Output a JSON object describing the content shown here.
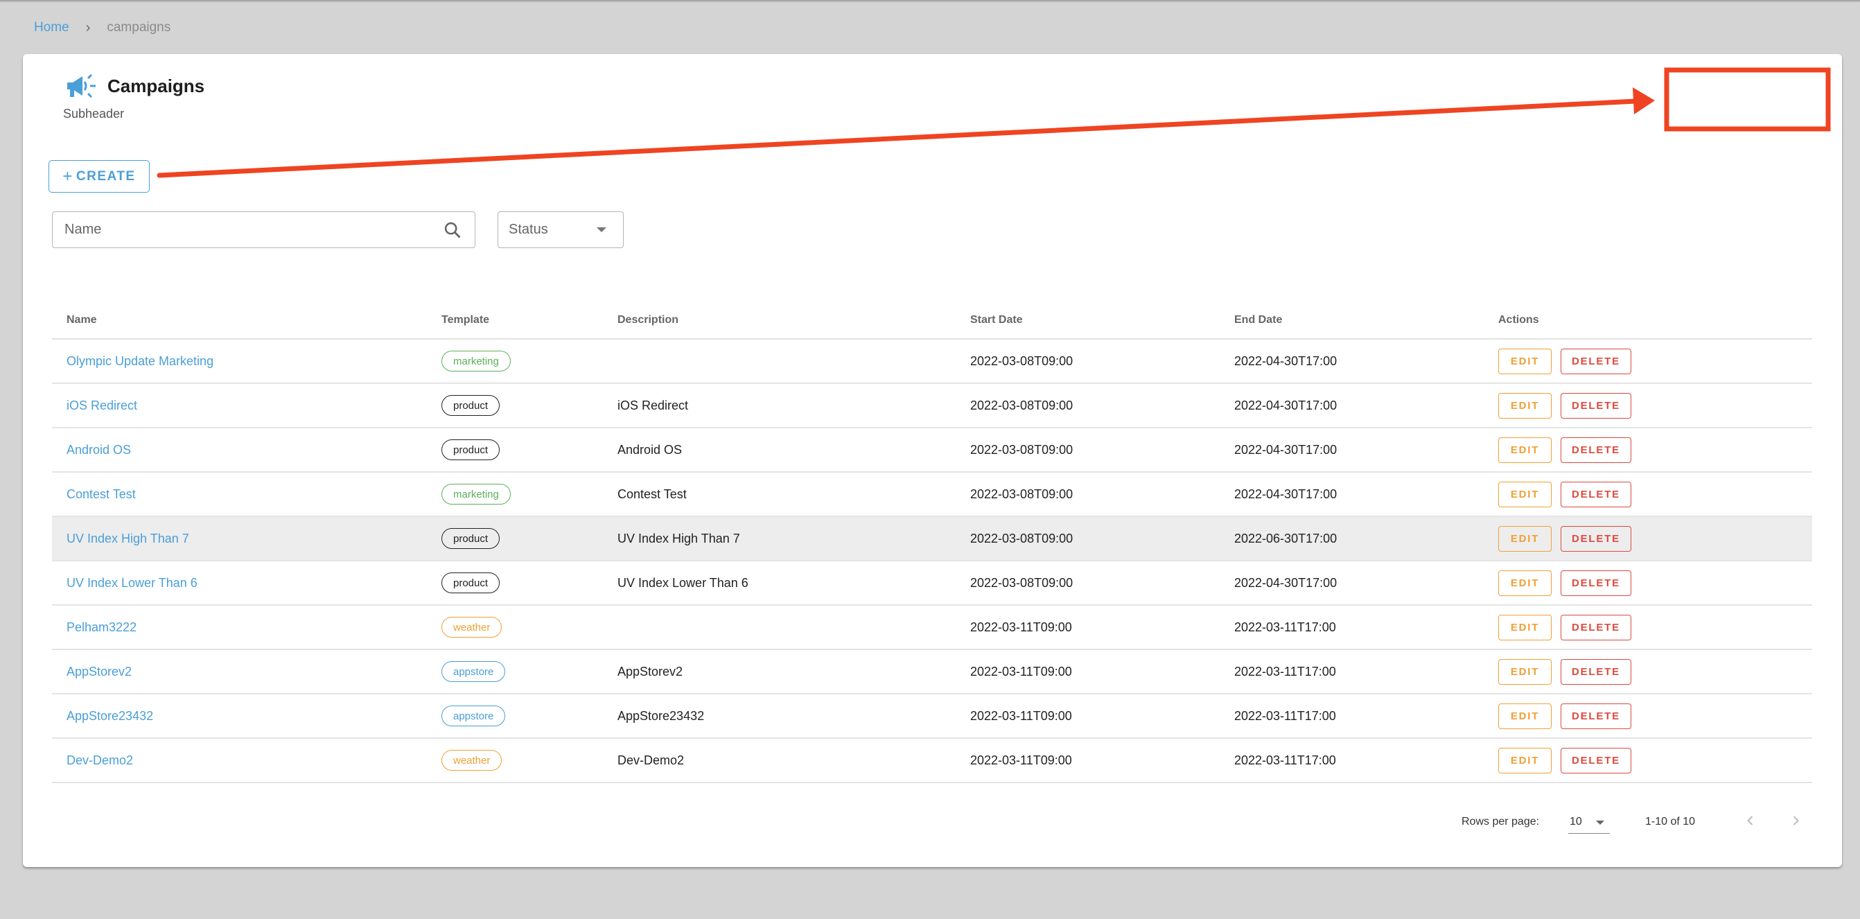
{
  "breadcrumb": {
    "home": "Home",
    "separator_icon": "chevron-right-icon",
    "current": "campaigns"
  },
  "header": {
    "icon": "megaphone-icon",
    "title": "Campaigns",
    "subheader": "Subheader",
    "accent_color": "#4a9fd8"
  },
  "toolbar": {
    "create_label": "CREATE",
    "create_icon": "plus-icon"
  },
  "filters": {
    "name_placeholder": "Name",
    "name_value": "",
    "search_icon": "search-icon",
    "status_placeholder": "Status"
  },
  "table": {
    "columns": [
      "Name",
      "Template",
      "Description",
      "Start Date",
      "End Date",
      "Actions"
    ],
    "edit_label": "EDIT",
    "delete_label": "DELETE",
    "template_colors": {
      "marketing": "#5cb05c",
      "product": "#222222",
      "weather": "#f0a035",
      "appstore": "#4a9fd8"
    },
    "rows": [
      {
        "name": "Olympic Update Marketing",
        "template": "marketing",
        "description": "",
        "start": "2022-03-08T09:00",
        "end": "2022-04-30T17:00",
        "highlighted": false
      },
      {
        "name": "iOS Redirect",
        "template": "product",
        "description": "iOS Redirect",
        "start": "2022-03-08T09:00",
        "end": "2022-04-30T17:00",
        "highlighted": false
      },
      {
        "name": "Android OS",
        "template": "product",
        "description": "Android OS",
        "start": "2022-03-08T09:00",
        "end": "2022-04-30T17:00",
        "highlighted": false
      },
      {
        "name": "Contest Test",
        "template": "marketing",
        "description": "Contest Test",
        "start": "2022-03-08T09:00",
        "end": "2022-04-30T17:00",
        "highlighted": false
      },
      {
        "name": "UV Index High Than 7",
        "template": "product",
        "description": "UV Index High Than 7",
        "start": "2022-03-08T09:00",
        "end": "2022-06-30T17:00",
        "highlighted": true
      },
      {
        "name": "UV Index Lower Than 6",
        "template": "product",
        "description": "UV Index Lower Than 6",
        "start": "2022-03-08T09:00",
        "end": "2022-04-30T17:00",
        "highlighted": false
      },
      {
        "name": "Pelham3222",
        "template": "weather",
        "description": "",
        "start": "2022-03-11T09:00",
        "end": "2022-03-11T17:00",
        "highlighted": false
      },
      {
        "name": "AppStorev2",
        "template": "appstore",
        "description": "AppStorev2",
        "start": "2022-03-11T09:00",
        "end": "2022-03-11T17:00",
        "highlighted": false
      },
      {
        "name": "AppStore23432",
        "template": "appstore",
        "description": "AppStore23432",
        "start": "2022-03-11T09:00",
        "end": "2022-03-11T17:00",
        "highlighted": false
      },
      {
        "name": "Dev-Demo2",
        "template": "weather",
        "description": "Dev-Demo2",
        "start": "2022-03-11T09:00",
        "end": "2022-03-11T17:00",
        "highlighted": false
      }
    ]
  },
  "pagination": {
    "rows_per_page_label": "Rows per page:",
    "rows_per_page": "10",
    "range": "1-10 of 10",
    "prev_icon": "chevron-left-icon",
    "next_icon": "chevron-right-icon"
  },
  "annotation": {
    "type": "hand-drawn arrow pointing from create button to empty box",
    "color": "#ee4422"
  }
}
